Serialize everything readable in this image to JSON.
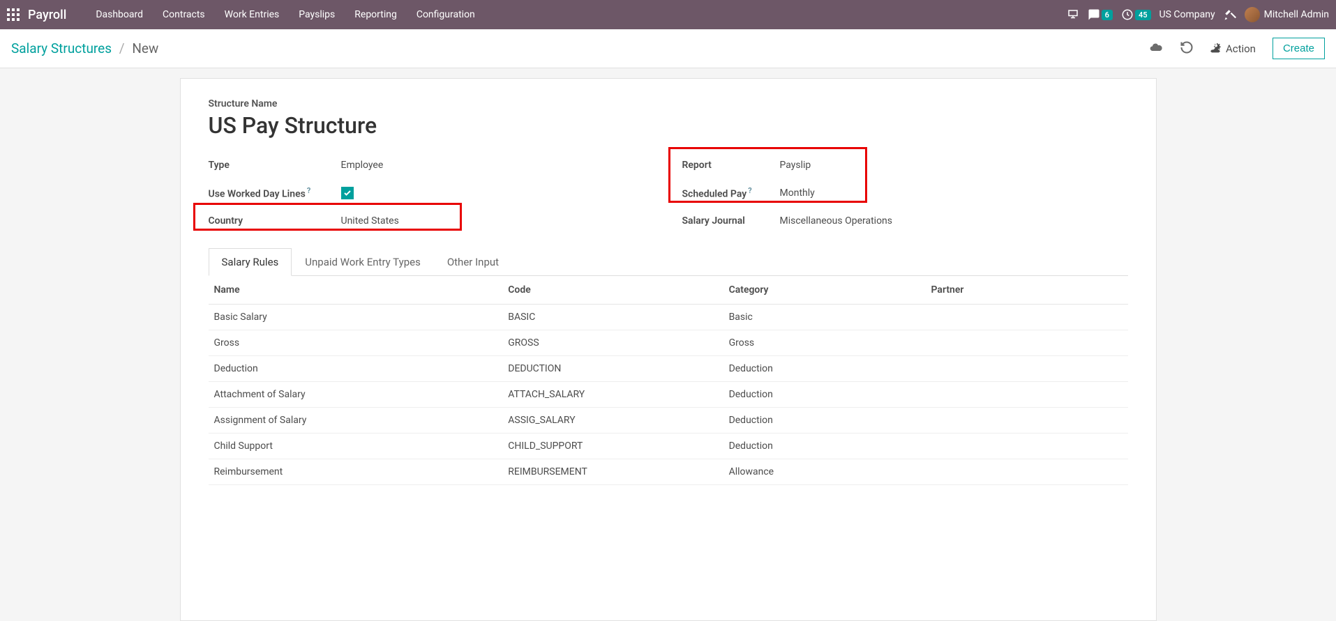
{
  "topbar": {
    "app_name": "Payroll",
    "menu": [
      "Dashboard",
      "Contracts",
      "Work Entries",
      "Payslips",
      "Reporting",
      "Configuration"
    ],
    "chat_badge": "6",
    "clock_badge": "45",
    "company": "US Company",
    "user": "Mitchell Admin"
  },
  "controlbar": {
    "breadcrumb_root": "Salary Structures",
    "breadcrumb_current": "New",
    "action_label": "Action",
    "create_label": "Create"
  },
  "form": {
    "structure_name_label": "Structure Name",
    "structure_name_value": "US Pay Structure",
    "left": {
      "type_label": "Type",
      "type_value": "Employee",
      "worked_day_label": "Use Worked Day Lines",
      "worked_day_checked": true,
      "country_label": "Country",
      "country_value": "United States"
    },
    "right": {
      "report_label": "Report",
      "report_value": "Payslip",
      "scheduled_label": "Scheduled Pay",
      "scheduled_value": "Monthly",
      "journal_label": "Salary Journal",
      "journal_value": "Miscellaneous Operations"
    }
  },
  "tabs": [
    "Salary Rules",
    "Unpaid Work Entry Types",
    "Other Input"
  ],
  "table": {
    "headers": [
      "Name",
      "Code",
      "Category",
      "Partner"
    ],
    "rows": [
      {
        "name": "Basic Salary",
        "code": "BASIC",
        "category": "Basic",
        "partner": ""
      },
      {
        "name": "Gross",
        "code": "GROSS",
        "category": "Gross",
        "partner": ""
      },
      {
        "name": "Deduction",
        "code": "DEDUCTION",
        "category": "Deduction",
        "partner": ""
      },
      {
        "name": "Attachment of Salary",
        "code": "ATTACH_SALARY",
        "category": "Deduction",
        "partner": ""
      },
      {
        "name": "Assignment of Salary",
        "code": "ASSIG_SALARY",
        "category": "Deduction",
        "partner": ""
      },
      {
        "name": "Child Support",
        "code": "CHILD_SUPPORT",
        "category": "Deduction",
        "partner": ""
      },
      {
        "name": "Reimbursement",
        "code": "REIMBURSEMENT",
        "category": "Allowance",
        "partner": ""
      }
    ]
  }
}
